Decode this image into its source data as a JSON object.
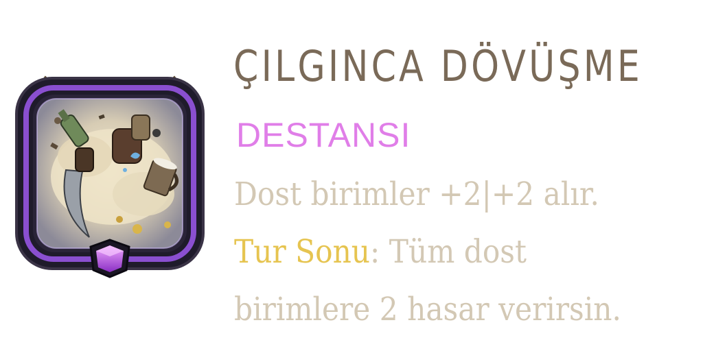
{
  "card": {
    "title": "ÇILGINCA DÖVÜŞME",
    "rarity": "DESTANSI",
    "description": {
      "line1": "Dost birimler +2|+2 alır.",
      "line2_keyword": "Tur Sonu",
      "line2_rest": ": Tüm dost",
      "line3": "birimlere 2 hasar verirsin."
    },
    "icon": "brawl-artwork-icon",
    "gem_icon": "epic-gem-icon"
  },
  "colors": {
    "title": "#7a6a58",
    "rarity": "#e07ee8",
    "description": "#d3c8b4",
    "keyword": "#e6c450",
    "frame_purple": "#8a4fd0",
    "frame_dark": "#2a2438",
    "frame_gold": "#b8a27a",
    "gem": "#b450f0"
  }
}
